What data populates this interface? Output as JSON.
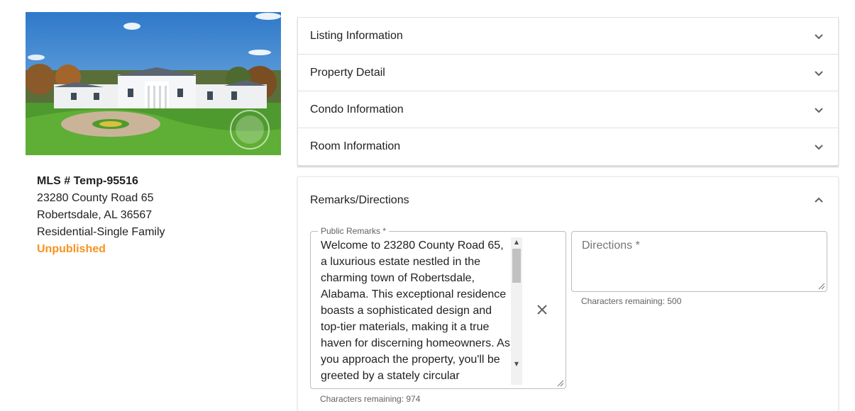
{
  "listing": {
    "image_alt": "Luxury white estate house with circular driveway",
    "mls_number": "MLS # Temp-95516",
    "address_line1": "23280 County Road 65",
    "address_line2": "Robertsdale, AL 36567",
    "property_type": "Residential-Single Family",
    "status": "Unpublished",
    "status_color": "#f7931e"
  },
  "accordion": {
    "sections": [
      {
        "label": "Listing Information",
        "expanded": false
      },
      {
        "label": "Property Detail",
        "expanded": false
      },
      {
        "label": "Condo Information",
        "expanded": false
      },
      {
        "label": "Room Information",
        "expanded": false
      }
    ]
  },
  "remarks_panel": {
    "title": "Remarks/Directions",
    "expanded": true,
    "public_remarks": {
      "label": "Public Remarks *",
      "value": "Welcome to 23280 County Road 65, a luxurious estate nestled in the charming town of Robertsdale, Alabama. This exceptional residence boasts a sophisticated design and top-tier materials, making it a true haven for discerning homeowners. As you approach the property, you'll be greeted by a stately circular",
      "helper": "Characters remaining: 974"
    },
    "directions": {
      "label": "Directions *",
      "value": "",
      "helper": "Characters remaining: 500"
    }
  }
}
